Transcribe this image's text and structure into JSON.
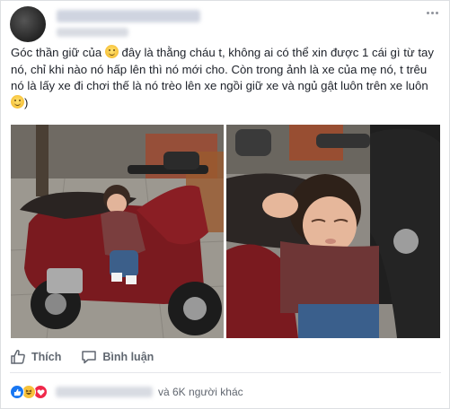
{
  "post": {
    "text_before_emoji_1": "Góc thần giữ của ",
    "text_after_emoji_1": " đây là thằng cháu t, không ai có thể xin được 1 cái gì từ tay nó, chỉ khi nào nó hấp lên thì nó mới cho. Còn trong ảnh là xe của mẹ nó, t trêu nó là lấy xe đi chơi thế là nó trèo lên xe ngồi giữ xe và ngủ gật luôn trên xe luôn ",
    "text_after_emoji_2": ")"
  },
  "icons": {
    "more": "more-options-icon",
    "emoji": "smiley-emoji-icon",
    "like": "thumbs-up-icon",
    "comment": "comment-bubble-icon",
    "reaction_like": "like-reaction-icon",
    "reaction_haha": "haha-reaction-icon",
    "reaction_love": "love-reaction-icon"
  },
  "actions": {
    "like_label": "Thích",
    "comment_label": "Bình luận"
  },
  "reactions": {
    "others_label": "và 6K người khác"
  },
  "colors": {
    "facebook_blue": "#1877f2",
    "text_primary": "#1d2129",
    "text_secondary": "#606770",
    "haha_yellow": "#f7c23b",
    "love_red": "#f0284a"
  }
}
